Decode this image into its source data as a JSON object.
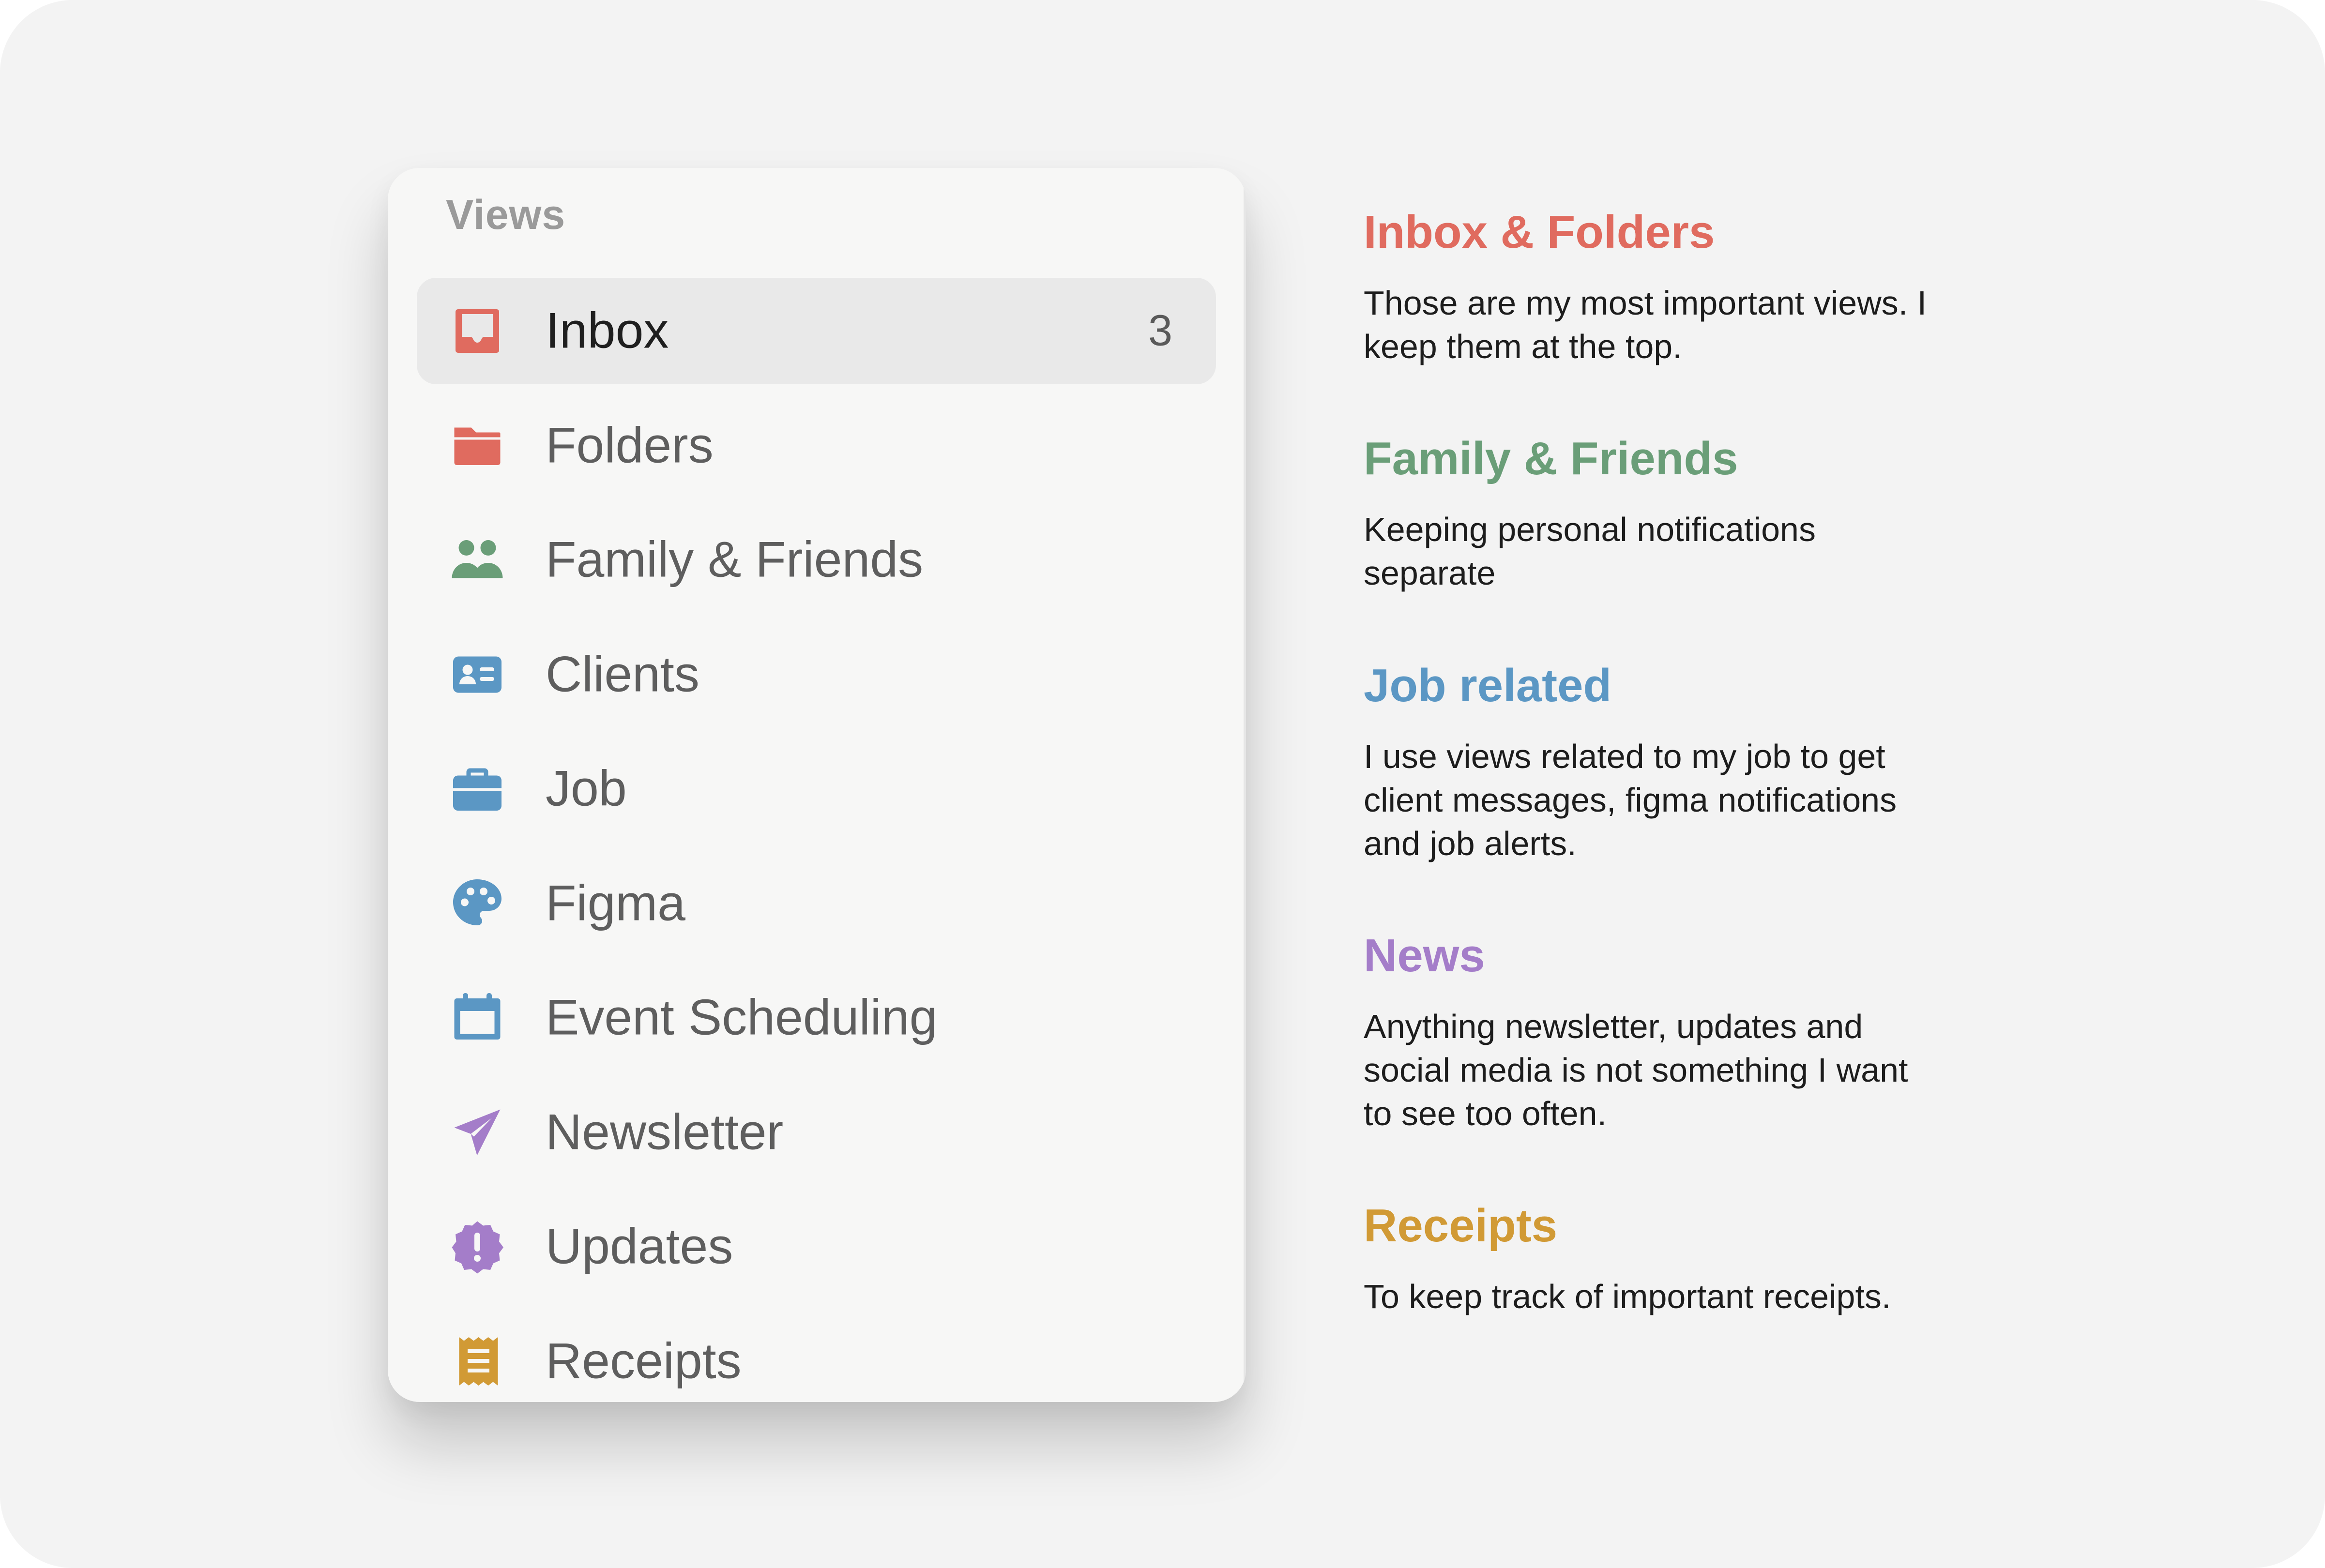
{
  "sidebar": {
    "heading": "Views",
    "items": [
      {
        "label": "Inbox",
        "count": "3",
        "icon": "inbox-tray-icon",
        "color": "#e06b5f",
        "active": true
      },
      {
        "label": "Folders",
        "icon": "folder-icon",
        "color": "#e06b5f"
      },
      {
        "label": "Family & Friends",
        "icon": "people-icon",
        "color": "#6a9e78"
      },
      {
        "label": "Clients",
        "icon": "contact-card-icon",
        "color": "#5b97c4"
      },
      {
        "label": "Job",
        "icon": "briefcase-icon",
        "color": "#5b97c4"
      },
      {
        "label": "Figma",
        "icon": "palette-icon",
        "color": "#5b97c4"
      },
      {
        "label": "Event Scheduling",
        "icon": "calendar-icon",
        "color": "#5b97c4"
      },
      {
        "label": "Newsletter",
        "icon": "paper-plane-icon",
        "color": "#a47dc9"
      },
      {
        "label": "Updates",
        "icon": "alert-badge-icon",
        "color": "#a47dc9"
      },
      {
        "label": "Receipts",
        "icon": "receipt-icon",
        "color": "#d19a35"
      }
    ]
  },
  "descriptions": [
    {
      "title": "Inbox & Folders",
      "color": "#e06b5f",
      "text": "Those are my most important views. I keep them at the top."
    },
    {
      "title": "Family & Friends",
      "color": "#6a9e78",
      "text": "Keeping personal notifications separate"
    },
    {
      "title": "Job related",
      "color": "#5b97c4",
      "text": "I use views related to my job to get client messages, figma notifications and job alerts."
    },
    {
      "title": "News",
      "color": "#a47dc9",
      "text": "Anything newsletter, updates and social media is not something I want to see too often."
    },
    {
      "title": "Receipts",
      "color": "#d19a35",
      "text": "To keep track of important receipts."
    }
  ]
}
